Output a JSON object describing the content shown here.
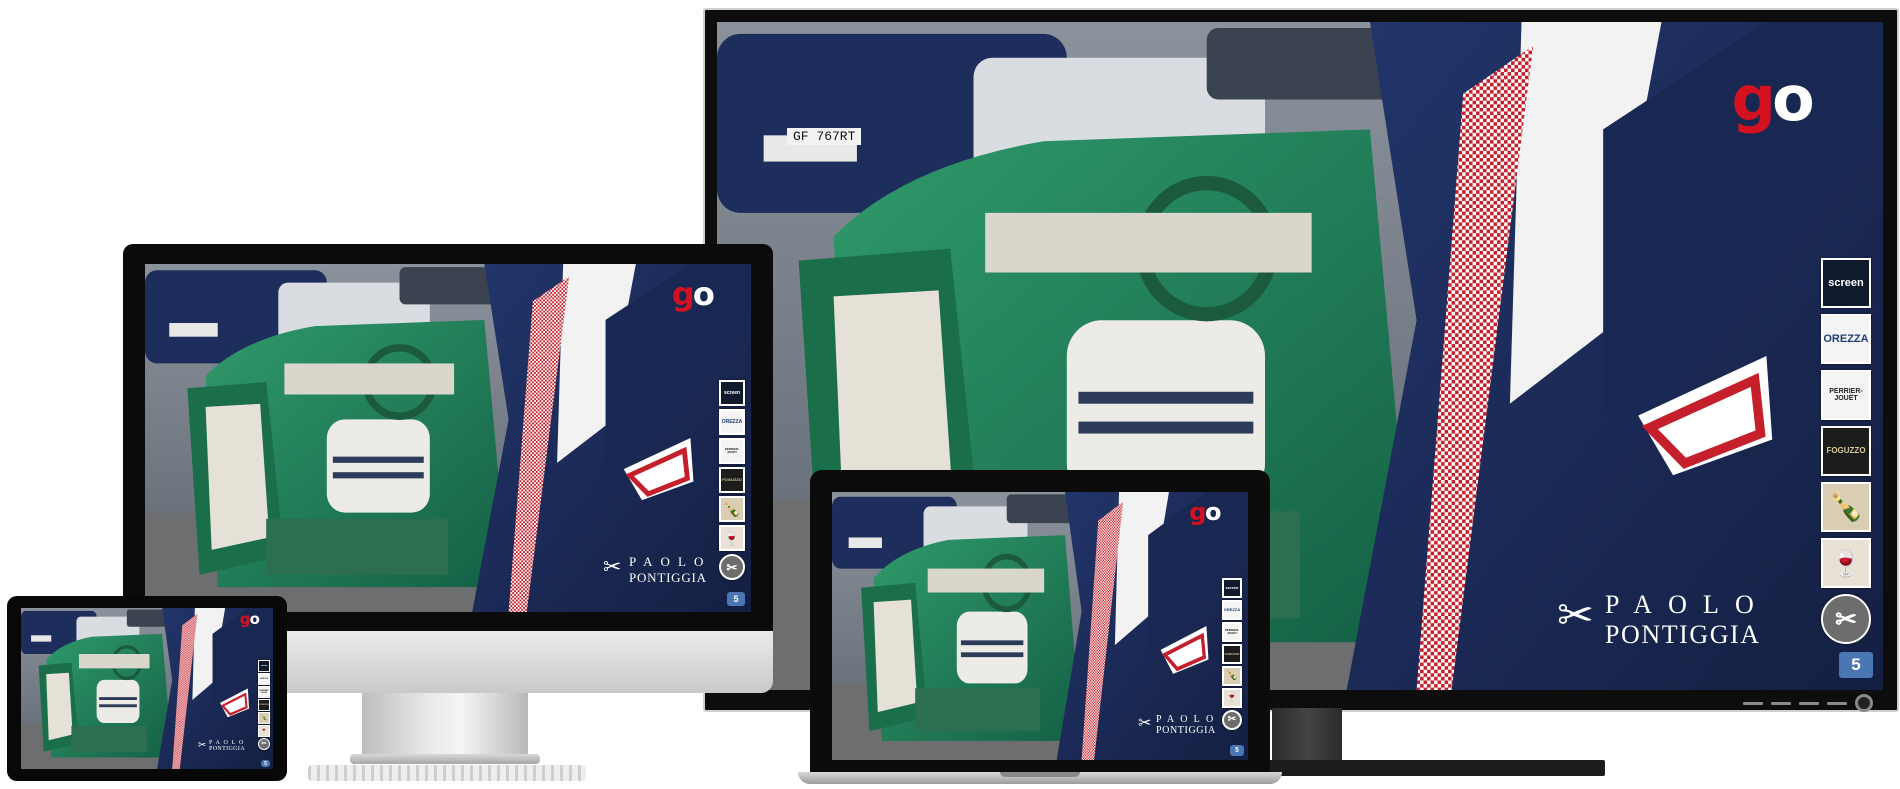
{
  "brand": {
    "logo_main": "g",
    "logo_accent": "o",
    "name_line1": "PAOLO",
    "name_line2": "PONTIGGIA"
  },
  "car": {
    "plate": "GF 767RT"
  },
  "sidebar": {
    "sponsors": [
      {
        "name": "screen-logo",
        "label": "screen"
      },
      {
        "name": "orezza-logo",
        "label": "OREZZA"
      },
      {
        "name": "perrier-jouet-logo",
        "label": "PERRIER-JOUËT"
      },
      {
        "name": "foguzzo-logo",
        "label": "FOGUZZO"
      },
      {
        "name": "product-bottle-icon",
        "label": ""
      },
      {
        "name": "wine-bottles-icon",
        "label": ""
      },
      {
        "name": "paolo-pontiggia-emblem-icon",
        "label": ""
      }
    ],
    "nav_badge": "5"
  },
  "colors": {
    "accent_red": "#d4121f",
    "car_green": "#1f7a52",
    "suit_navy": "#1b2b57",
    "badge_blue": "#4a76b4"
  }
}
